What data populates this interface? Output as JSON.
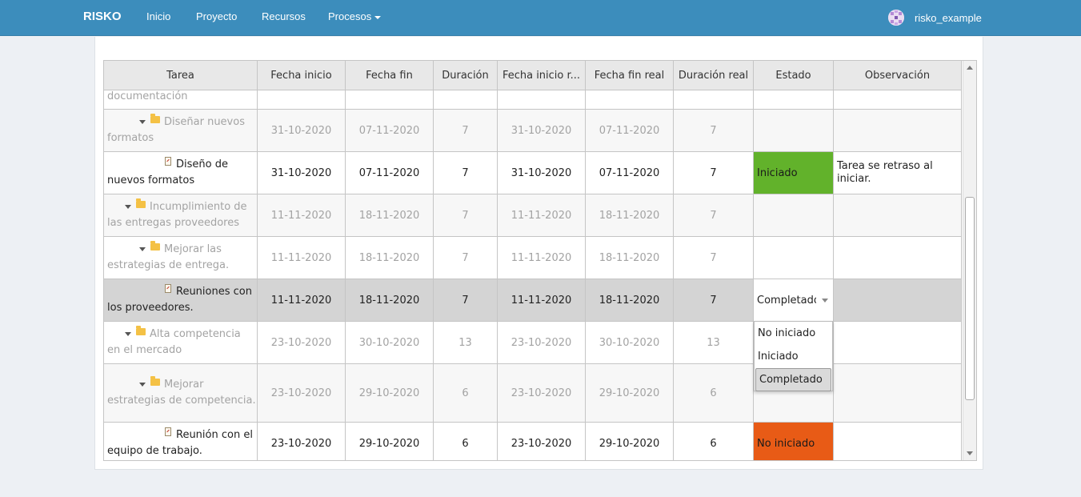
{
  "nav": {
    "brand": "RISKO",
    "links": [
      "Inicio",
      "Proyecto",
      "Recursos",
      "Procesos"
    ],
    "username": "risko_example"
  },
  "table": {
    "columns": [
      "Tarea",
      "Fecha inicio",
      "Fecha fin",
      "Duración",
      "Fecha inicio r...",
      "Fecha fin real",
      "Duración real",
      "Estado",
      "Observación"
    ],
    "rows": [
      {
        "tarea": "documentación",
        "fecha_inicio": "",
        "fecha_fin": "",
        "duracion": "",
        "fecha_inicio_real": "",
        "fecha_fin_real": "",
        "duracion_real": "",
        "estado": "",
        "observacion": ""
      },
      {
        "tarea": "Diseñar nuevos formatos",
        "fecha_inicio": "31-10-2020",
        "fecha_fin": "07-11-2020",
        "duracion": "7",
        "fecha_inicio_real": "31-10-2020",
        "fecha_fin_real": "07-11-2020",
        "duracion_real": "7",
        "estado": "",
        "observacion": ""
      },
      {
        "tarea": "Diseño de nuevos formatos",
        "fecha_inicio": "31-10-2020",
        "fecha_fin": "07-11-2020",
        "duracion": "7",
        "fecha_inicio_real": "31-10-2020",
        "fecha_fin_real": "07-11-2020",
        "duracion_real": "7",
        "estado": "Iniciado",
        "observacion": "Tarea se retraso al iniciar."
      },
      {
        "tarea": "Incumplimiento de las entregas proveedores",
        "fecha_inicio": "11-11-2020",
        "fecha_fin": "18-11-2020",
        "duracion": "7",
        "fecha_inicio_real": "11-11-2020",
        "fecha_fin_real": "18-11-2020",
        "duracion_real": "7",
        "estado": "",
        "observacion": ""
      },
      {
        "tarea": "Mejorar las estrategias de entrega.",
        "fecha_inicio": "11-11-2020",
        "fecha_fin": "18-11-2020",
        "duracion": "7",
        "fecha_inicio_real": "11-11-2020",
        "fecha_fin_real": "18-11-2020",
        "duracion_real": "7",
        "estado": "",
        "observacion": ""
      },
      {
        "tarea": "Reuniones con los proveedores.",
        "fecha_inicio": "11-11-2020",
        "fecha_fin": "18-11-2020",
        "duracion": "7",
        "fecha_inicio_real": "11-11-2020",
        "fecha_fin_real": "18-11-2020",
        "duracion_real": "7",
        "estado": "Completado",
        "observacion": ""
      },
      {
        "tarea": "Alta competencia en el mercado",
        "fecha_inicio": "23-10-2020",
        "fecha_fin": "30-10-2020",
        "duracion": "13",
        "fecha_inicio_real": "23-10-2020",
        "fecha_fin_real": "30-10-2020",
        "duracion_real": "13",
        "estado": "",
        "observacion": ""
      },
      {
        "tarea": "Mejorar estrategias de competencia.",
        "fecha_inicio": "23-10-2020",
        "fecha_fin": "29-10-2020",
        "duracion": "6",
        "fecha_inicio_real": "23-10-2020",
        "fecha_fin_real": "29-10-2020",
        "duracion_real": "6",
        "estado": "",
        "observacion": ""
      },
      {
        "tarea": "Reunión con el equipo de trabajo.",
        "fecha_inicio": "23-10-2020",
        "fecha_fin": "29-10-2020",
        "duracion": "6",
        "fecha_inicio_real": "23-10-2020",
        "fecha_fin_real": "29-10-2020",
        "duracion_real": "6",
        "estado": "No iniciado",
        "observacion": ""
      }
    ],
    "estado_options": [
      "No iniciado",
      "Iniciado",
      "Completado"
    ]
  },
  "colors": {
    "navbar": "#3c8dbc",
    "iniciado": "#62b22b",
    "no_iniciado": "#e85b16",
    "selected_row": "#d4d4d4"
  }
}
